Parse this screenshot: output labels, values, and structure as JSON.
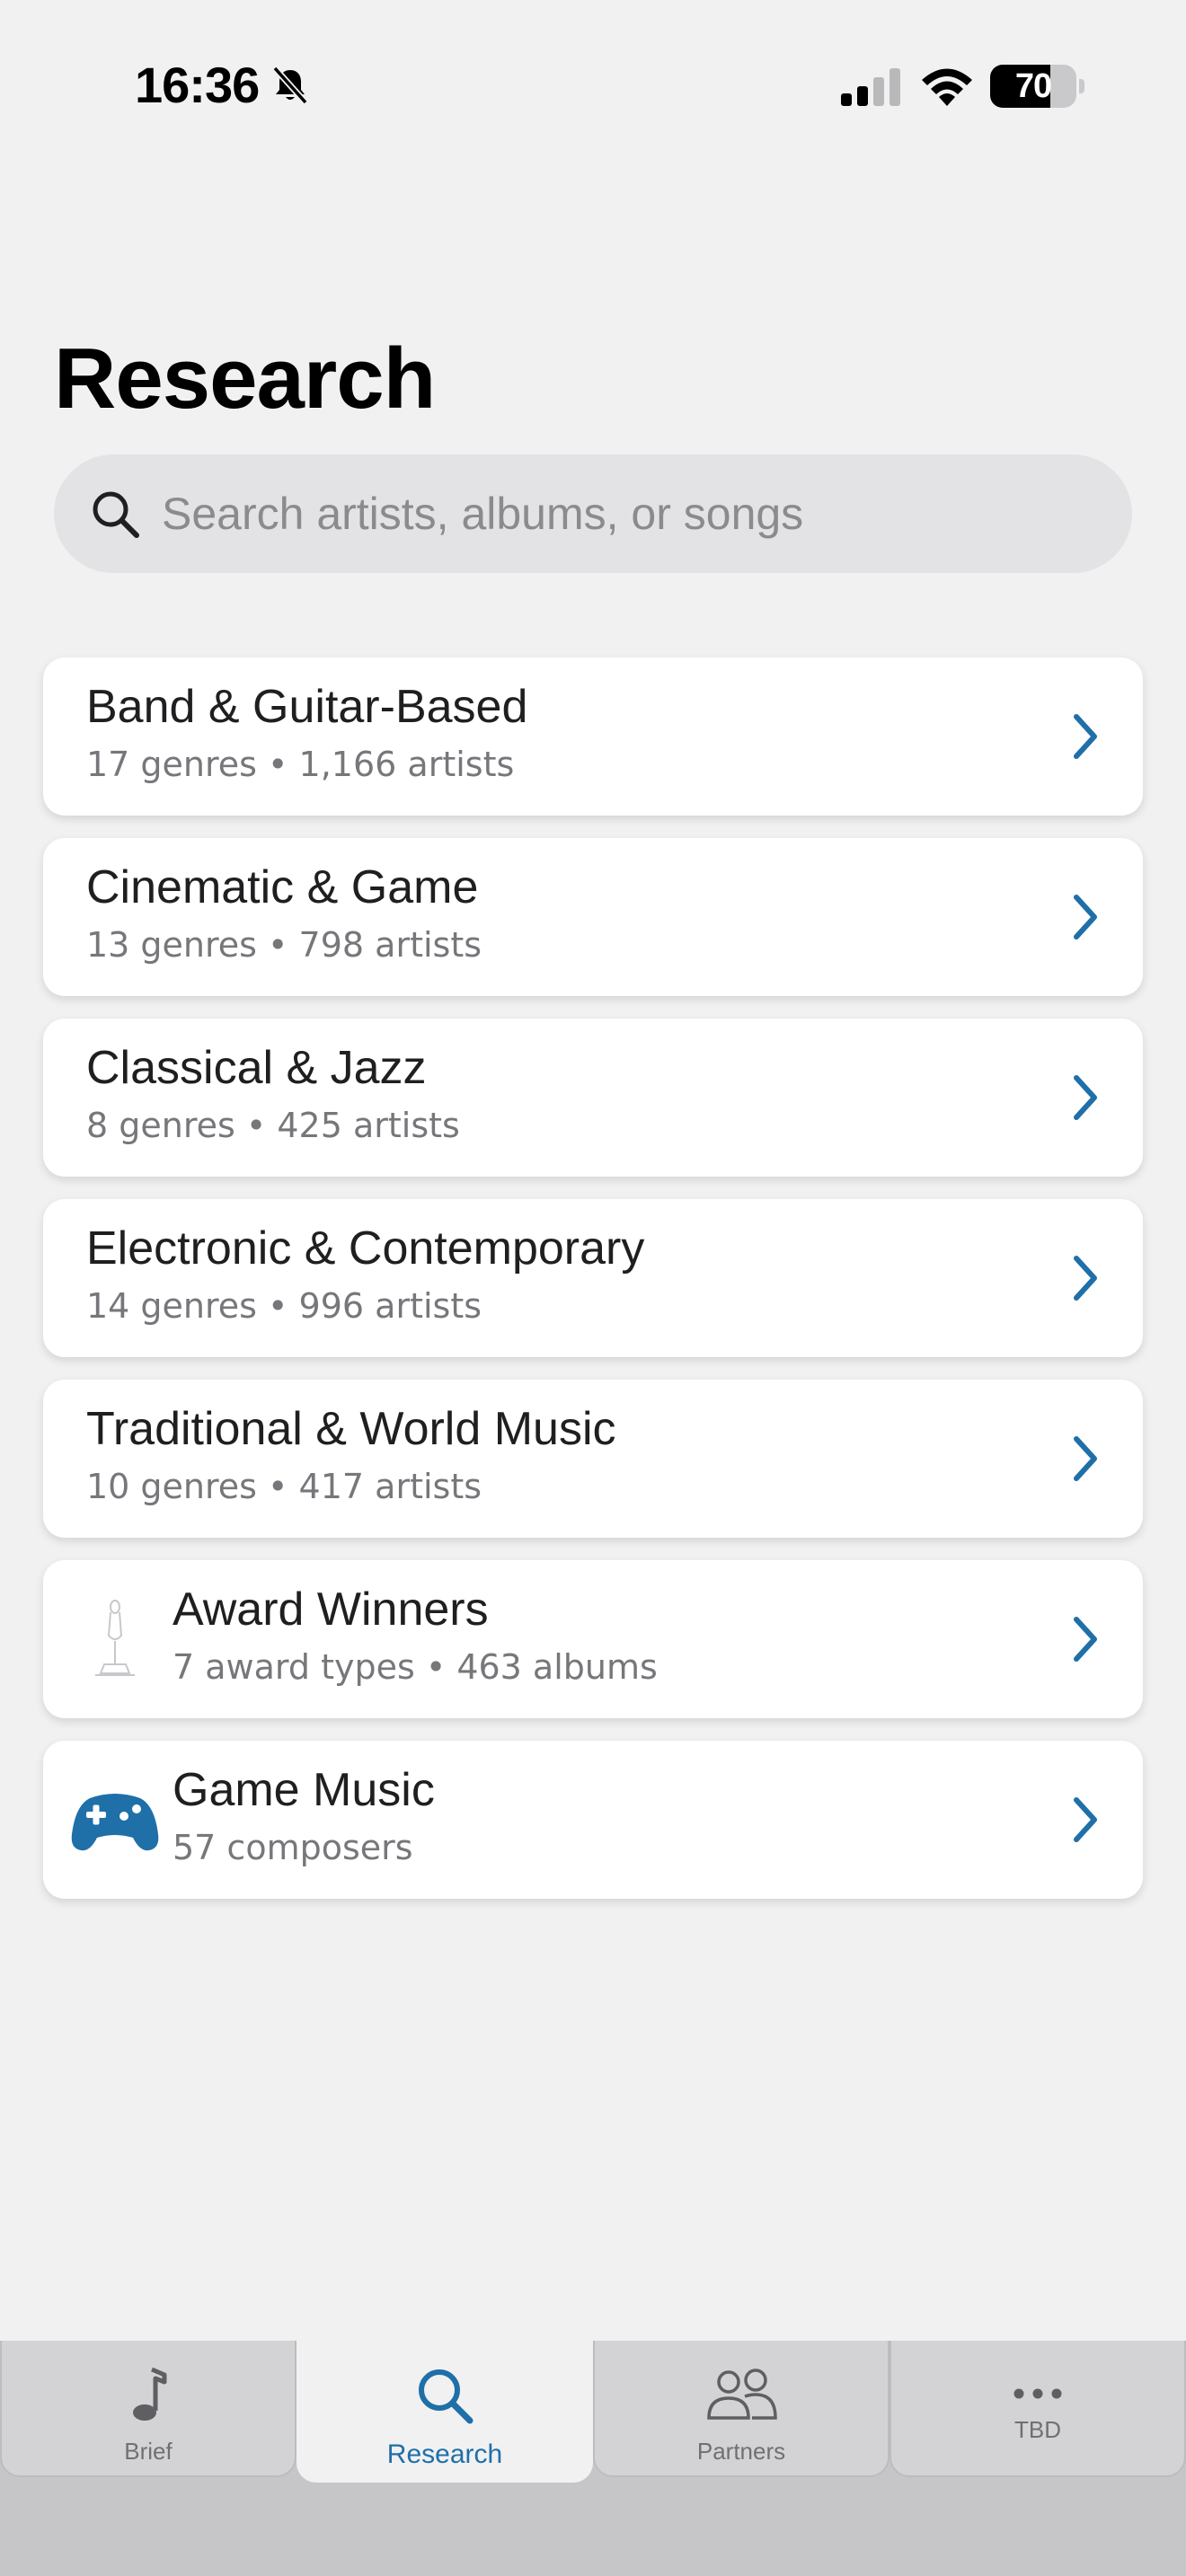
{
  "status_bar": {
    "time": "16:36",
    "battery_percent": 70,
    "battery_label": "70"
  },
  "page": {
    "title": "Research"
  },
  "search": {
    "placeholder": "Search artists, albums, or songs",
    "value": ""
  },
  "categories": [
    {
      "title": "Band & Guitar-Based",
      "subtitle": "17 genres • 1,166 artists"
    },
    {
      "title": "Cinematic & Game",
      "subtitle": "13 genres • 798 artists"
    },
    {
      "title": "Classical & Jazz",
      "subtitle": "8 genres • 425 artists"
    },
    {
      "title": "Electronic & Contemporary",
      "subtitle": "14 genres • 996 artists"
    },
    {
      "title": "Traditional & World Music",
      "subtitle": "10 genres • 417 artists"
    },
    {
      "title": "Award Winners",
      "subtitle": "7 award types • 463 albums",
      "icon": "trophy-icon"
    },
    {
      "title": "Game Music",
      "subtitle": "57 composers",
      "icon": "gamepad-icon"
    }
  ],
  "tab_bar": {
    "tabs": [
      {
        "label": "Brief",
        "icon": "music-note-icon"
      },
      {
        "label": "Research",
        "icon": "search-icon",
        "active": true
      },
      {
        "label": "Partners",
        "icon": "people-icon"
      },
      {
        "label": "TBD",
        "icon": "more-icon"
      }
    ]
  },
  "colors": {
    "accent": "#1f6fa8",
    "background": "#f1f1f2",
    "card": "#ffffff",
    "secondary_text": "#77777b"
  }
}
